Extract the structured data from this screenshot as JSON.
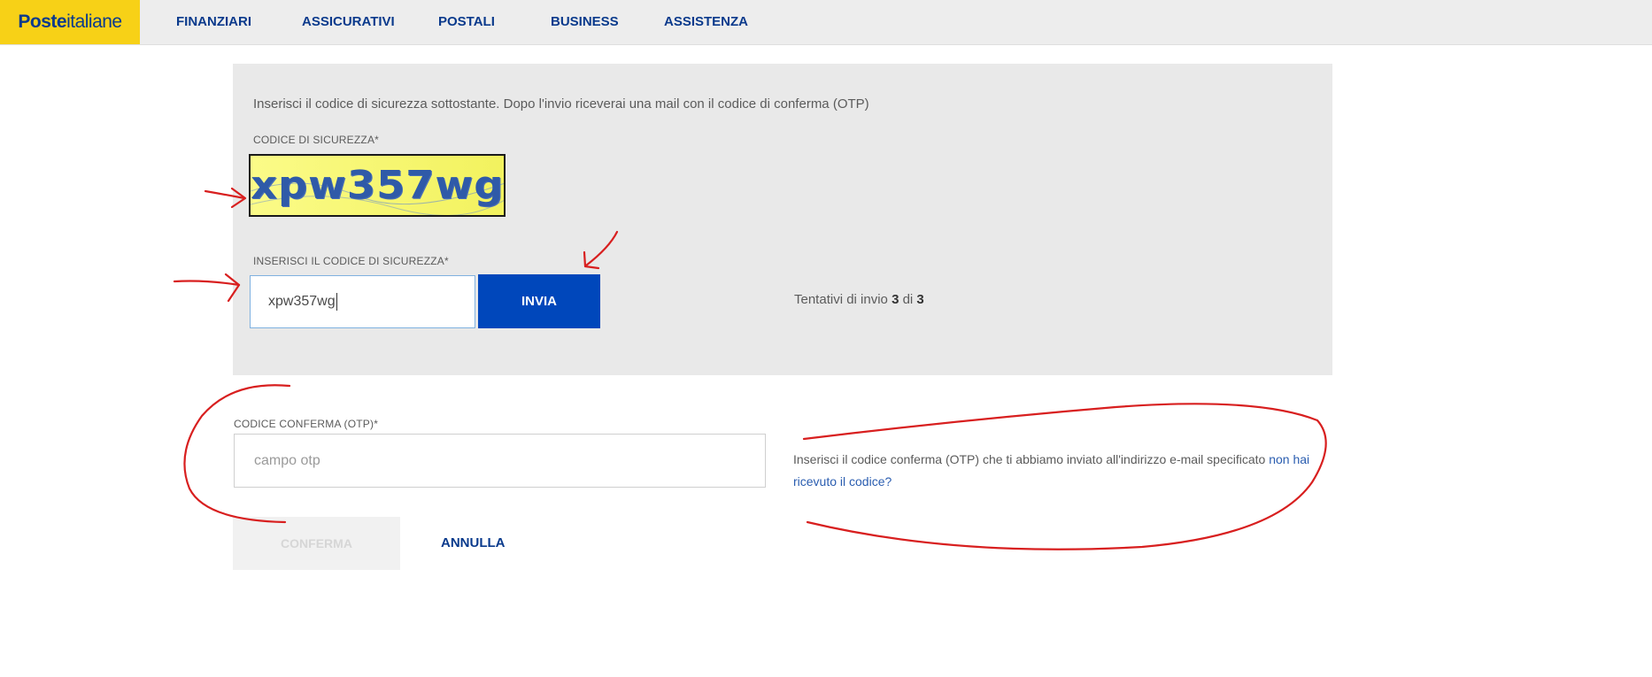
{
  "header": {
    "logo_strong": "Poste",
    "logo_light": "italiane",
    "nav": [
      "FINANZIARI",
      "ASSICURATIVI",
      "POSTALI",
      "BUSINESS",
      "ASSISTENZA"
    ]
  },
  "security": {
    "intro": "Inserisci il codice di sicurezza sottostante. Dopo l'invio riceverai una mail con il codice di conferma (OTP)",
    "captcha_label": "CODICE DI SICUREZZA*",
    "captcha_text": "xpw357wg",
    "input_label": "INSERISCI IL CODICE DI SICUREZZA*",
    "input_value": "xpw357wg",
    "submit_label": "INVIA",
    "attempts_prefix": "Tentativi di invio ",
    "attempts_current": "3",
    "attempts_middle": " di ",
    "attempts_total": "3"
  },
  "otp": {
    "label": "CODICE CONFERMA (OTP)*",
    "placeholder": "campo otp",
    "help_text": "Inserisci il codice conferma (OTP) che ti abbiamo inviato all'indirizzo e-mail specificato ",
    "help_link": "non hai ricevuto il codice?"
  },
  "actions": {
    "confirm_label": "CONFERMA",
    "cancel_label": "ANNULLA"
  },
  "colors": {
    "brand_yellow": "#f7d117",
    "brand_blue": "#0047bb",
    "annotation_red": "#d81f1f"
  }
}
